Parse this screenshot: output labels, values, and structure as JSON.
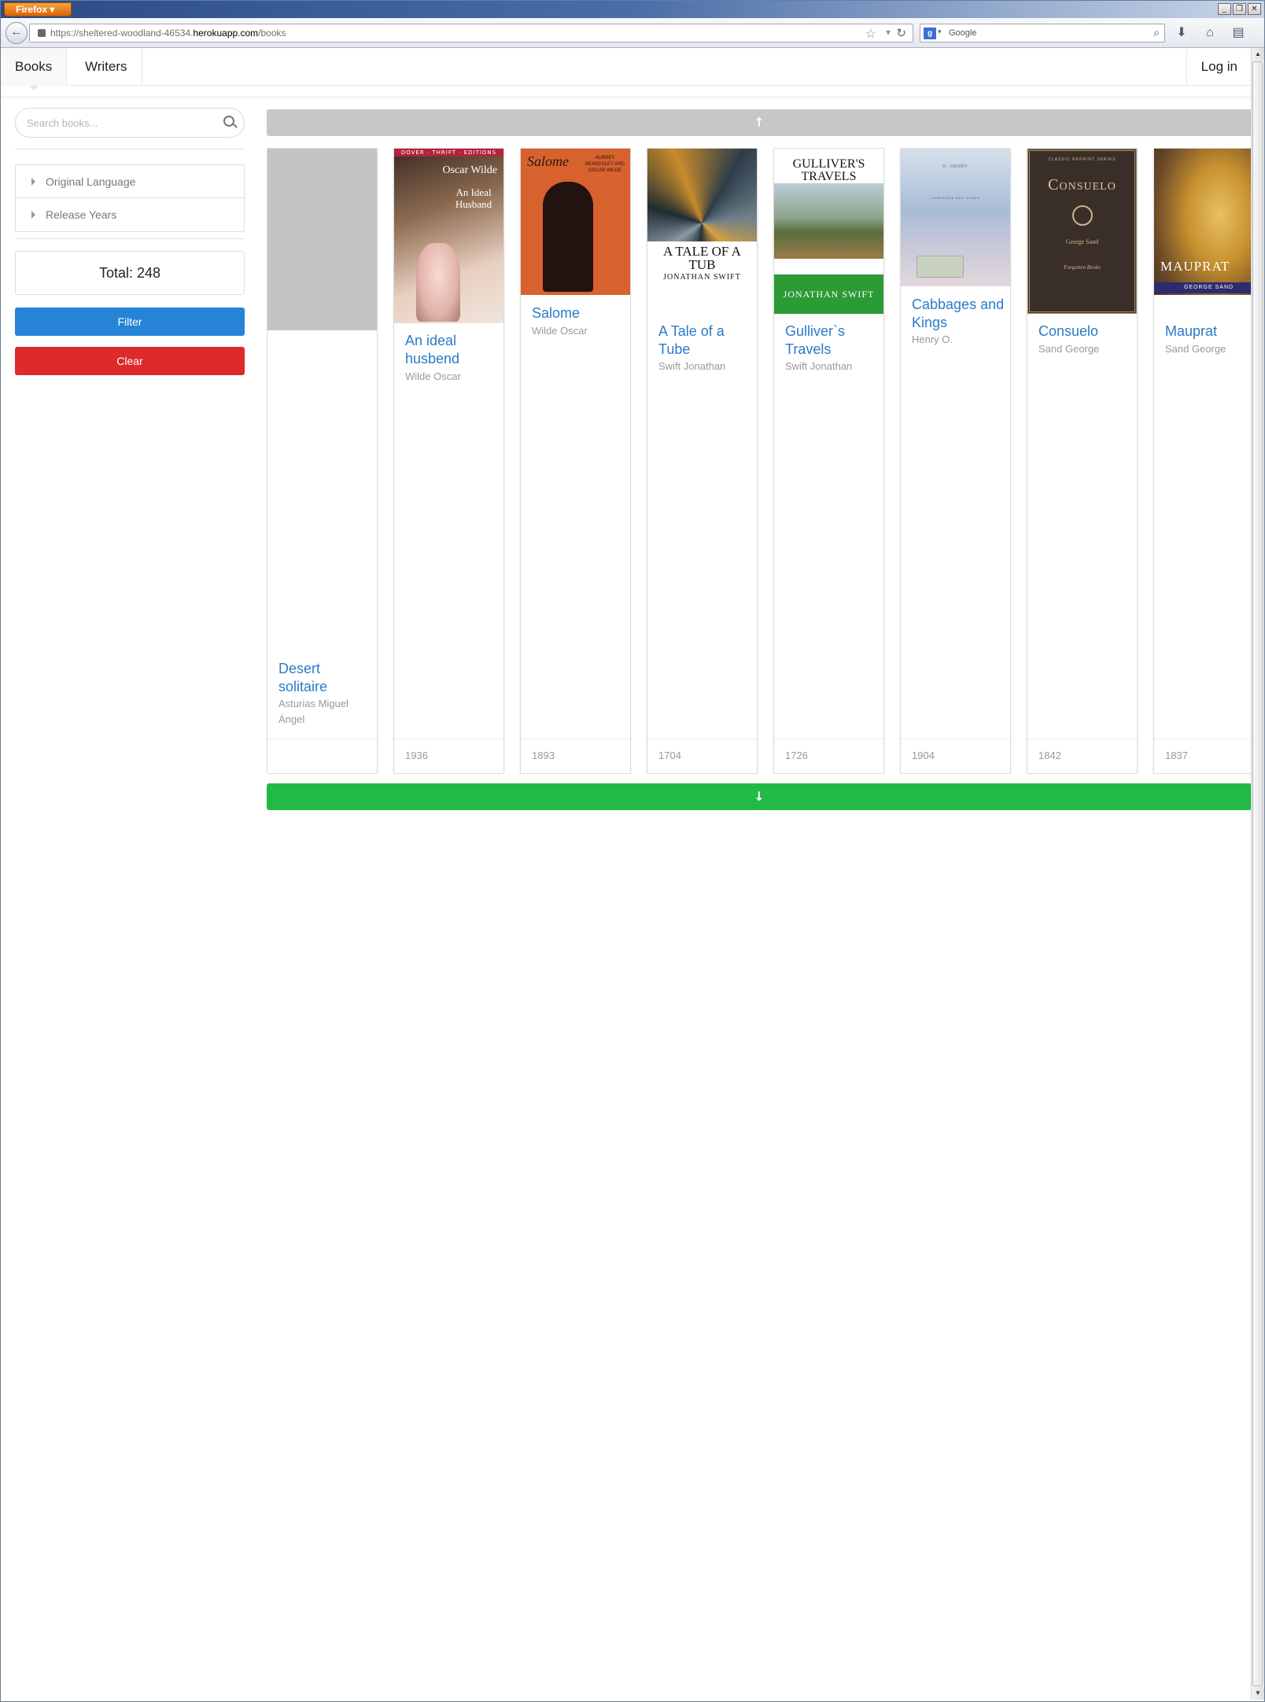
{
  "browser": {
    "app_button": "Firefox",
    "url_prefix": "https://sheltered-woodland-46534.",
    "url_host": "herokuapp.com",
    "url_path": "/books",
    "search_engine": "Google"
  },
  "nav": {
    "tabs": [
      {
        "label": "Books"
      },
      {
        "label": "Writers"
      }
    ],
    "login": "Log in"
  },
  "sidebar": {
    "search_placeholder": "Search books...",
    "filters": [
      {
        "label": "Original Language"
      },
      {
        "label": "Release Years"
      }
    ],
    "total": "Total: 248",
    "filter_button": "Filter",
    "clear_button": "Clear"
  },
  "books": [
    {
      "title": "Desert solitaire",
      "author": "Asturias Miguel Ángel",
      "year": "",
      "cover": "placeholder"
    },
    {
      "title": "An ideal husbend",
      "author": "Wilde Oscar",
      "year": "1936",
      "cover": "ideal",
      "cover_text": {
        "top": "DOVER · THRIFT · EDITIONS",
        "author": "Oscar Wilde",
        "title": "An Ideal Husband"
      }
    },
    {
      "title": "Salome",
      "author": "Wilde Oscar",
      "year": "1893",
      "cover": "salome",
      "cover_text": {
        "title": "Salome",
        "sub": "AUBREY BEARDSLEY AND OSCAR WILDE"
      }
    },
    {
      "title": "A Tale of a Tube",
      "author": "Swift Jonathan",
      "year": "1704",
      "cover": "tub",
      "cover_text": {
        "title": "A TALE OF A TUB",
        "author": "JONATHAN SWIFT"
      }
    },
    {
      "title": "Gulliver`s Travels",
      "author": "Swift Jonathan",
      "year": "1726",
      "cover": "gulliver",
      "cover_text": {
        "title": "GULLIVER'S TRAVELS",
        "author": "JONATHAN SWIFT"
      }
    },
    {
      "title": "Cabbages and Kings",
      "author": "Henry O.",
      "year": "1904",
      "cover": "cabbages",
      "cover_text": {
        "author": "O. HENRY",
        "title": "CABBAGES AND KINGS"
      }
    },
    {
      "title": "Consuelo",
      "author": "Sand George",
      "year": "1842",
      "cover": "consuelo",
      "cover_text": {
        "series": "CLASSIC REPRINT SERIES",
        "title": "Consuelo",
        "author": "George Sand",
        "publisher": "Forgotten Books"
      }
    },
    {
      "title": "Mauprat",
      "author": "Sand George",
      "year": "1837",
      "cover": "mauprat",
      "cover_text": {
        "title": "MAUPRAT",
        "author": "GEORGE SAND"
      }
    }
  ],
  "colors": {
    "link": "#2a7ac9",
    "filter": "#2583d8",
    "clear": "#dd2a2b",
    "scroll_down": "#22b945",
    "scroll_up": "#c7c7c7"
  }
}
